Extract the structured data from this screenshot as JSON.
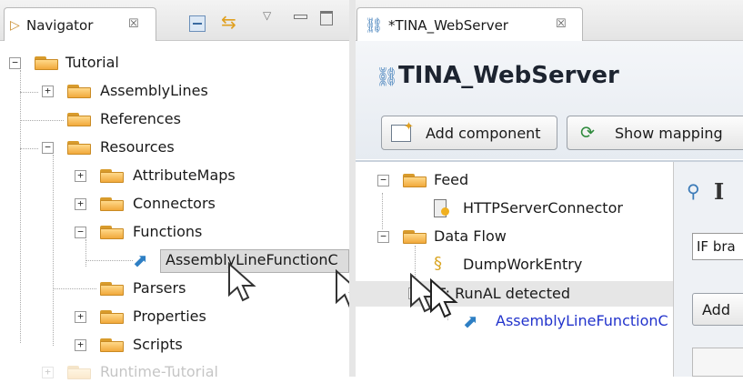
{
  "navigator": {
    "tab_label": "Navigator",
    "tab_close": "☒",
    "tree": [
      {
        "label": "Tutorial",
        "expander": "−"
      },
      {
        "label": "AssemblyLines",
        "expander": "+"
      },
      {
        "label": "References",
        "expander": ""
      },
      {
        "label": "Resources",
        "expander": "−"
      },
      {
        "label": "AttributeMaps",
        "expander": "+"
      },
      {
        "label": "Connectors",
        "expander": "+"
      },
      {
        "label": "Functions",
        "expander": "−"
      },
      {
        "label": "AssemblyLineFunctionC",
        "expander": ""
      },
      {
        "label": "Parsers",
        "expander": ""
      },
      {
        "label": "Properties",
        "expander": "+"
      },
      {
        "label": "Scripts",
        "expander": "+"
      },
      {
        "label": "Runtime-Tutorial",
        "expander": "+"
      }
    ]
  },
  "editor": {
    "tab_label": "*TINA_WebServer",
    "tab_close": "☒",
    "title": "TINA_WebServer",
    "buttons": {
      "add_component": "Add component",
      "show_mapping": "Show mapping"
    },
    "tree": [
      {
        "label": "Feed",
        "expander": "−"
      },
      {
        "label": "HTTPServerConnector",
        "expander": ""
      },
      {
        "label": "Data Flow",
        "expander": "−"
      },
      {
        "label": "DumpWorkEntry",
        "expander": ""
      },
      {
        "label": "IF: RunAL detected",
        "expander": "−"
      },
      {
        "label": "AssemblyLineFunctionC",
        "expander": ""
      }
    ],
    "side": {
      "heading_partial": "I",
      "input_value": "IF bra",
      "add_button": "Add"
    }
  }
}
